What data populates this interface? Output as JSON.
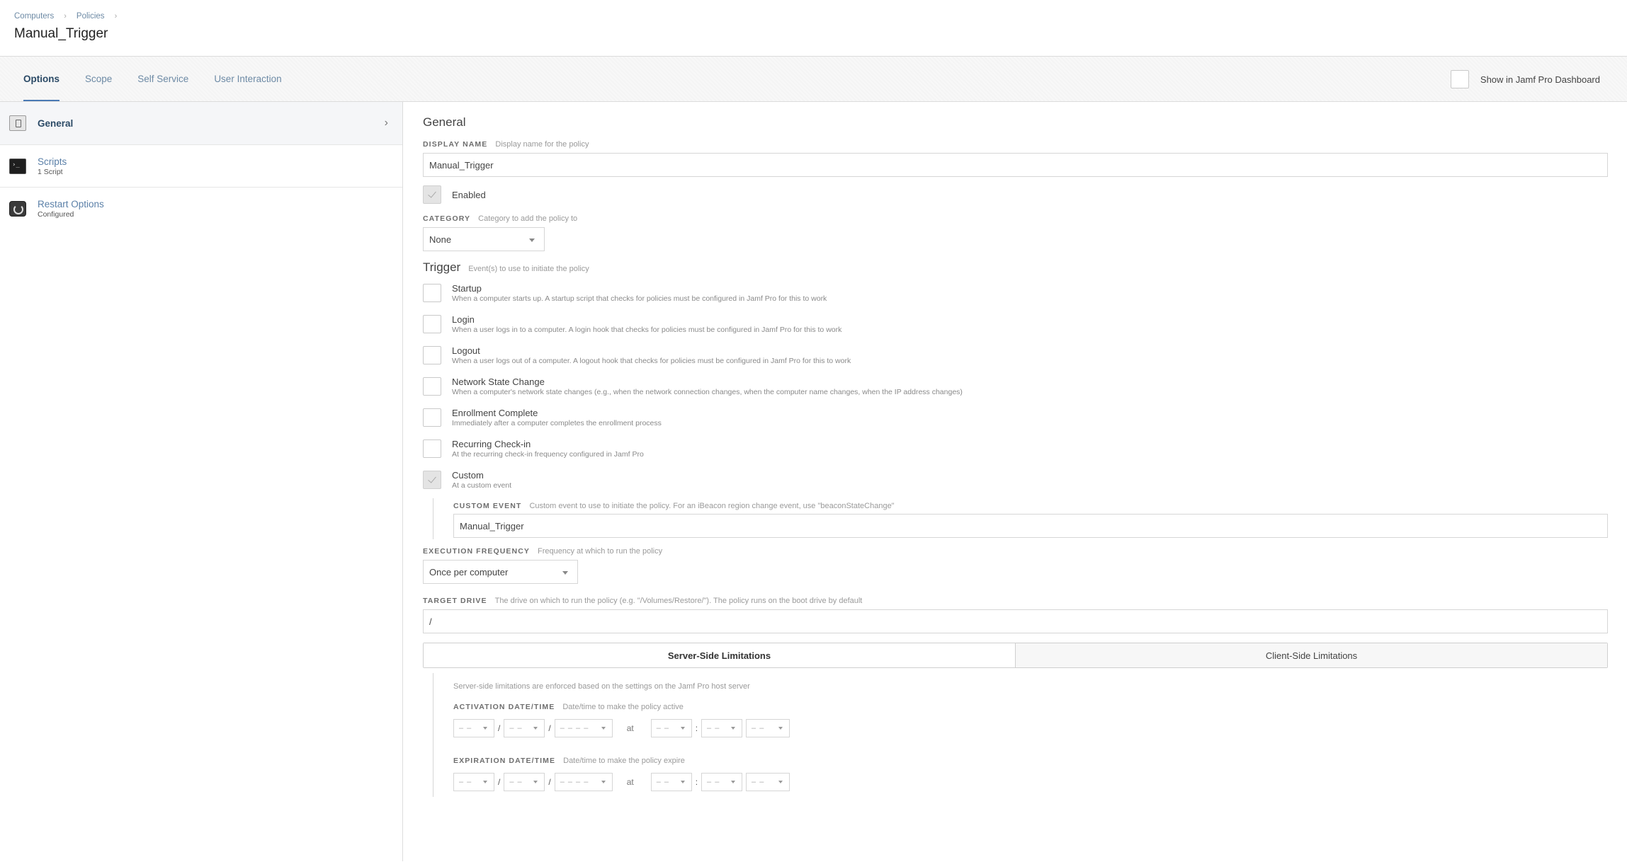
{
  "breadcrumb": {
    "items": [
      "Computers",
      "Policies"
    ],
    "separator": "›"
  },
  "page_title": "Manual_Trigger",
  "tabs": [
    {
      "label": "Options",
      "active": true
    },
    {
      "label": "Scope",
      "active": false
    },
    {
      "label": "Self Service",
      "active": false
    },
    {
      "label": "User Interaction",
      "active": false
    }
  ],
  "dashboard_toggle": {
    "label": "Show in Jamf Pro Dashboard",
    "checked": false
  },
  "sidebar": {
    "items": [
      {
        "label": "General",
        "sub": "",
        "icon": "general-icon",
        "active": true,
        "chevron": "›"
      },
      {
        "label": "Scripts",
        "sub": "1 Script",
        "icon": "terminal-icon",
        "active": false
      },
      {
        "label": "Restart Options",
        "sub": "Configured",
        "icon": "restart-icon",
        "active": false
      }
    ]
  },
  "general": {
    "section_title": "General",
    "display_name": {
      "label": "DISPLAY NAME",
      "hint": "Display name for the policy",
      "value": "Manual_Trigger"
    },
    "enabled": {
      "label": "Enabled",
      "checked": true
    },
    "category": {
      "label": "CATEGORY",
      "hint": "Category to add the policy to",
      "value": "None"
    }
  },
  "trigger": {
    "title": "Trigger",
    "hint": "Event(s) to use to initiate the policy",
    "items": [
      {
        "name": "Startup",
        "desc": "When a computer starts up. A startup script that checks for policies must be configured in Jamf Pro for this to work",
        "checked": false
      },
      {
        "name": "Login",
        "desc": "When a user logs in to a computer. A login hook that checks for policies must be configured in Jamf Pro for this to work",
        "checked": false
      },
      {
        "name": "Logout",
        "desc": "When a user logs out of a computer. A logout hook that checks for policies must be configured in Jamf Pro for this to work",
        "checked": false
      },
      {
        "name": "Network State Change",
        "desc": "When a computer's network state changes (e.g., when the network connection changes, when the computer name changes, when the IP address changes)",
        "checked": false
      },
      {
        "name": "Enrollment Complete",
        "desc": "Immediately after a computer completes the enrollment process",
        "checked": false
      },
      {
        "name": "Recurring Check-in",
        "desc": "At the recurring check-in frequency configured in Jamf Pro",
        "checked": false
      },
      {
        "name": "Custom",
        "desc": "At a custom event",
        "checked": true
      }
    ],
    "custom_event": {
      "label": "CUSTOM EVENT",
      "hint": "Custom event to use to initiate the policy. For an iBeacon region change event, use \"beaconStateChange\"",
      "value": "Manual_Trigger"
    }
  },
  "execution_frequency": {
    "label": "EXECUTION FREQUENCY",
    "hint": "Frequency at which to run the policy",
    "value": "Once per computer"
  },
  "target_drive": {
    "label": "TARGET DRIVE",
    "hint": "The drive on which to run the policy (e.g. \"/Volumes/Restore/\"). The policy runs on the boot drive by default",
    "value": "/"
  },
  "limitations": {
    "tabs": [
      "Server-Side Limitations",
      "Client-Side Limitations"
    ],
    "note": "Server-side limitations are enforced based on the settings on the Jamf Pro host server",
    "activation": {
      "label": "ACTIVATION DATE/TIME",
      "hint": "Date/time to make the policy active"
    },
    "expiration": {
      "label": "EXPIRATION DATE/TIME",
      "hint": "Date/time to make the policy expire"
    },
    "placeholders": {
      "two": "– –",
      "four": "– – – –"
    },
    "date_sep": "/",
    "time_sep": ":",
    "at": "at"
  }
}
